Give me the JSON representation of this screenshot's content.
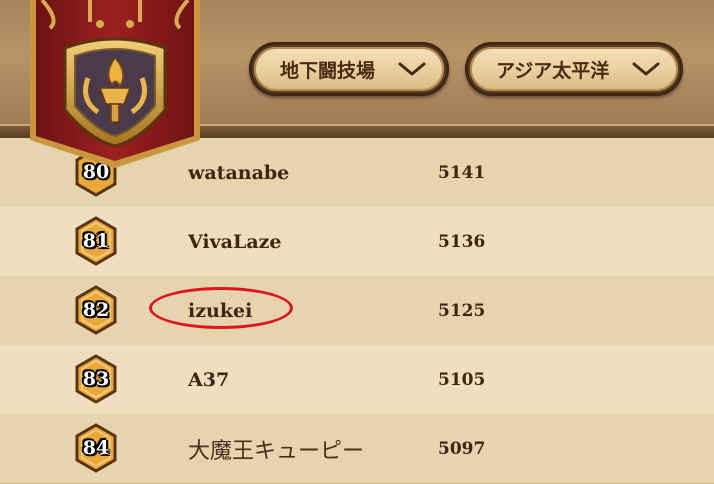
{
  "filters": {
    "mode_label": "地下闘技場",
    "region_label": "アジア太平洋"
  },
  "leaderboard": {
    "rows": [
      {
        "rank": "80",
        "name": "watanabe",
        "score": "5141"
      },
      {
        "rank": "81",
        "name": "VivaLaze",
        "score": "5136"
      },
      {
        "rank": "82",
        "name": "izukei",
        "score": "5125"
      },
      {
        "rank": "83",
        "name": "A37",
        "score": "5105"
      },
      {
        "rank": "84",
        "name": "大魔王キューピー",
        "score": "5097"
      }
    ],
    "highlighted_player": "izukei"
  },
  "icons": {
    "banner": "torch-emblem-icon",
    "dropdown": "chevron-down-icon",
    "rank": "hexagon-rank-badge-icon"
  },
  "colors": {
    "highlight": "#e0141e",
    "banner_red": "#8e1b1b",
    "gold": "#c9973e"
  }
}
